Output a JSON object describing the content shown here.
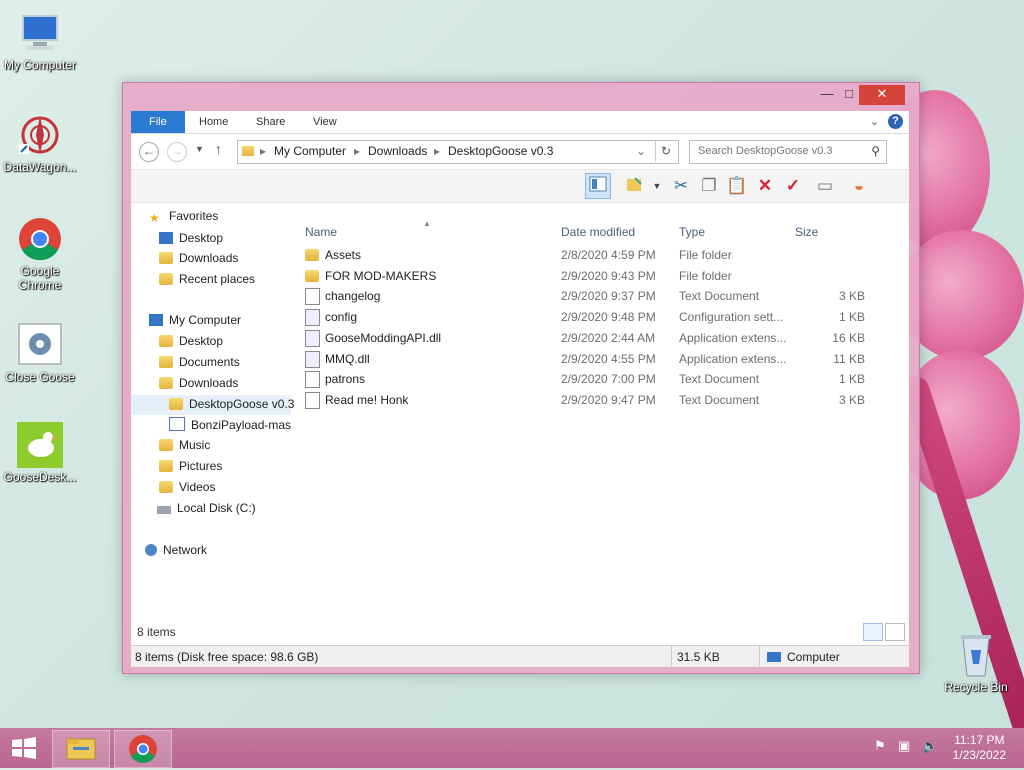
{
  "desktop": {
    "icons": [
      {
        "label": "My Computer",
        "icon": "computer-icon"
      },
      {
        "label": "DataWagon...",
        "icon": "datawagon-icon"
      },
      {
        "label": "Google Chrome",
        "icon": "chrome-icon"
      },
      {
        "label": "Close Goose",
        "icon": "close-goose-icon"
      },
      {
        "label": "GooseDesk...",
        "icon": "goose-icon"
      },
      {
        "label": "Recycle Bin",
        "icon": "recycle-bin-icon"
      }
    ]
  },
  "window": {
    "controls": {
      "minimize": "—",
      "maximize": "□",
      "close": "✕"
    },
    "ribbon_tabs": [
      "File",
      "Home",
      "Share",
      "View"
    ],
    "breadcrumb": [
      "My Computer",
      "Downloads",
      "DesktopGoose v0.3"
    ],
    "search_placeholder": "Search DesktopGoose v0.3",
    "nav": {
      "favorites": "Favorites",
      "fav_items": [
        "Desktop",
        "Downloads",
        "Recent places"
      ],
      "computer": "My Computer",
      "computer_items": [
        "Desktop",
        "Documents",
        "Downloads"
      ],
      "download_children": [
        "DesktopGoose v0.3",
        "BonziPayload-mas"
      ],
      "more_items": [
        "Music",
        "Pictures",
        "Videos",
        "Local Disk (C:)"
      ],
      "network": "Network"
    },
    "columns": {
      "name": "Name",
      "date": "Date modified",
      "type": "Type",
      "size": "Size"
    },
    "files": [
      {
        "name": "Assets",
        "date": "2/8/2020 4:59 PM",
        "type": "File folder",
        "size": "",
        "kind": "folder"
      },
      {
        "name": "FOR MOD-MAKERS",
        "date": "2/9/2020 9:43 PM",
        "type": "File folder",
        "size": "",
        "kind": "folder"
      },
      {
        "name": "changelog",
        "date": "2/9/2020 9:37 PM",
        "type": "Text Document",
        "size": "3 KB",
        "kind": "doc"
      },
      {
        "name": "config",
        "date": "2/9/2020 9:48 PM",
        "type": "Configuration sett...",
        "size": "1 KB",
        "kind": "cfg"
      },
      {
        "name": "GooseModdingAPI.dll",
        "date": "2/9/2020 2:44 AM",
        "type": "Application extens...",
        "size": "16 KB",
        "kind": "cfg"
      },
      {
        "name": "MMQ.dll",
        "date": "2/9/2020 4:55 PM",
        "type": "Application extens...",
        "size": "11 KB",
        "kind": "cfg"
      },
      {
        "name": "patrons",
        "date": "2/9/2020 7:00 PM",
        "type": "Text Document",
        "size": "1 KB",
        "kind": "doc"
      },
      {
        "name": "Read me! Honk",
        "date": "2/9/2020 9:47 PM",
        "type": "Text Document",
        "size": "3 KB",
        "kind": "doc"
      }
    ],
    "item_count": "8 items",
    "status": {
      "left": "8 items (Disk free space: 98.6 GB)",
      "size": "31.5 KB",
      "location": "Computer"
    }
  },
  "taskbar": {
    "time": "11:17 PM",
    "date": "1/23/2022"
  },
  "colors": {
    "accent": "#2a7ad2",
    "window_frame": "#e8a8c8",
    "taskbar": "#b86690"
  }
}
